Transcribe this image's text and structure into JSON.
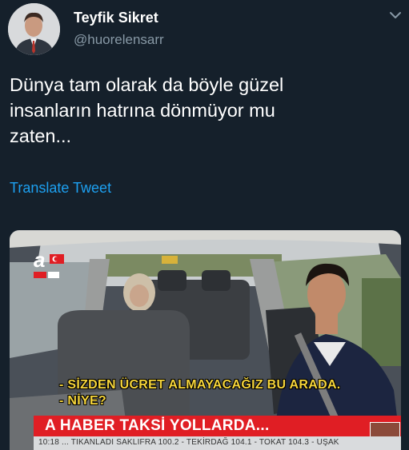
{
  "author": {
    "display_name": "Teyfik Sikret",
    "handle": "@huorelensarr"
  },
  "tweet": {
    "lines": [
      "Dünya tam olarak da böyle güzel",
      "insanların hatrına dönmüyor mu",
      "zaten..."
    ],
    "translate_label": "Translate Tweet"
  },
  "media": {
    "subtitle_lines": [
      "- SİZDEN ÜCRET ALMAYACAĞIZ BU ARADA.",
      "- NİYE?"
    ],
    "banner_title": "A HABER TAKSİ YOLLARDA...",
    "ticker": "10:18 ... TIKANLADI SAKLIFRA 100.2 - TEKİRDAĞ 104.1 - TOKAT 104.3 - UŞAK"
  },
  "colors": {
    "background": "#15202b",
    "link": "#1da1f2",
    "secondary_text": "#8899a6",
    "banner_red": "#e01e24",
    "subtitle_yellow": "#f5d43a"
  },
  "icons": {
    "menu": "chevron-down-icon",
    "channel_logo": "a-haber-logo-icon"
  }
}
